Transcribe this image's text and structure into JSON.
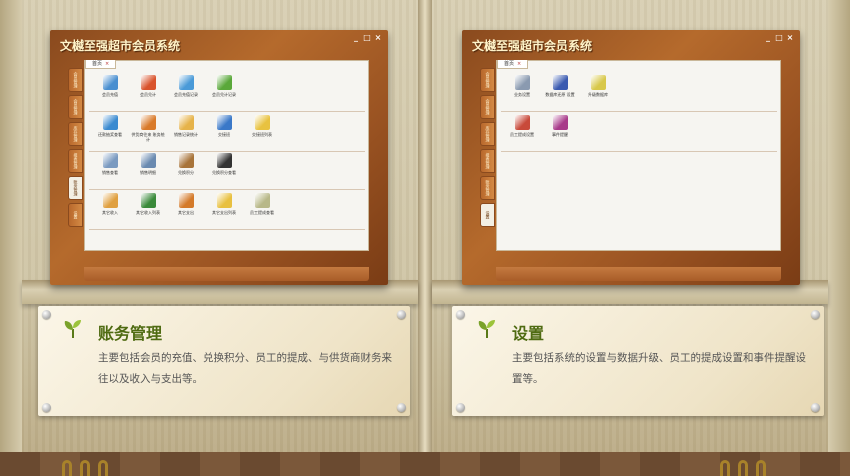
{
  "left": {
    "window": {
      "title": "文樾至强超市会员系统",
      "tab_label": "首页",
      "side_tabs": [
        "会员管理",
        "会员管理",
        "库存管理",
        "报表管理",
        "账务管理",
        "设置"
      ],
      "active_tab_index": 4,
      "rows": [
        [
          {
            "label": "会员充值",
            "icon": "card-icon",
            "color": "#4a8fd0"
          },
          {
            "label": "会员兑计",
            "icon": "target-icon",
            "color": "#d9532c"
          },
          {
            "label": "会员充值记录",
            "icon": "folder-icon",
            "color": "#4a9ad8"
          },
          {
            "label": "会员兑计记录",
            "icon": "folder-check-icon",
            "color": "#5aa83a"
          }
        ],
        [
          {
            "label": "还款抽奖查看",
            "icon": "globe-icon",
            "color": "#3a8ad0"
          },
          {
            "label": "供货商往来 账务统计",
            "icon": "gear-icon",
            "color": "#d97a2a"
          },
          {
            "label": "销售记录统计",
            "icon": "folder-icon",
            "color": "#e6b34a"
          },
          {
            "label": "交接班",
            "icon": "user-icon",
            "color": "#3a78c8"
          },
          {
            "label": "交接班列表",
            "icon": "notepad-icon",
            "color": "#e8c240"
          }
        ],
        [
          {
            "label": "销售查看",
            "icon": "search-icon",
            "color": "#7a9ac0"
          },
          {
            "label": "销售明细",
            "icon": "search-icon",
            "color": "#6a8ab0"
          },
          {
            "label": "兑换积分",
            "icon": "hourglass-icon",
            "color": "#a8743a"
          },
          {
            "label": "兑换积分查看",
            "icon": "binoculars-icon",
            "color": "#333333"
          }
        ],
        [
          {
            "label": "其它收入",
            "icon": "folder-icon",
            "color": "#e0a040"
          },
          {
            "label": "其它收入列表",
            "icon": "book-icon",
            "color": "#3a8a3a"
          },
          {
            "label": "其它支出",
            "icon": "folder-icon",
            "color": "#d47a2a"
          },
          {
            "label": "其它支出列表",
            "icon": "folder-icon",
            "color": "#e8c040"
          },
          {
            "label": "员工提成查看",
            "icon": "document-icon",
            "color": "#b8b888"
          }
        ]
      ]
    },
    "note": {
      "title": "账务管理",
      "body": "主要包括会员的充值、兑换积分、员工的提成、与供货商财务来往以及收入与支出等。"
    }
  },
  "right": {
    "window": {
      "title": "文樾至强超市会员系统",
      "tab_label": "首页",
      "side_tabs": [
        "会员管理",
        "会员管理",
        "库存管理",
        "报表管理",
        "账务管理",
        "设置"
      ],
      "active_tab_index": 5,
      "rows": [
        [
          {
            "label": "业务设置",
            "icon": "database-icon",
            "color": "#8a9ab0"
          },
          {
            "label": "数据库还原 设置",
            "icon": "computer-icon",
            "color": "#3a5ab0"
          },
          {
            "label": "升级数据库",
            "icon": "folder-icon",
            "color": "#d8c84a"
          }
        ],
        [
          {
            "label": "员工提成设置",
            "icon": "book-icon",
            "color": "#c84a3a"
          },
          {
            "label": "事件提醒",
            "icon": "books-icon",
            "color": "#a83a8a"
          }
        ]
      ]
    },
    "note": {
      "title": "设置",
      "body": "主要包括系统的设置与数据升级、员工的提成设置和事件提醒设置等。"
    }
  }
}
